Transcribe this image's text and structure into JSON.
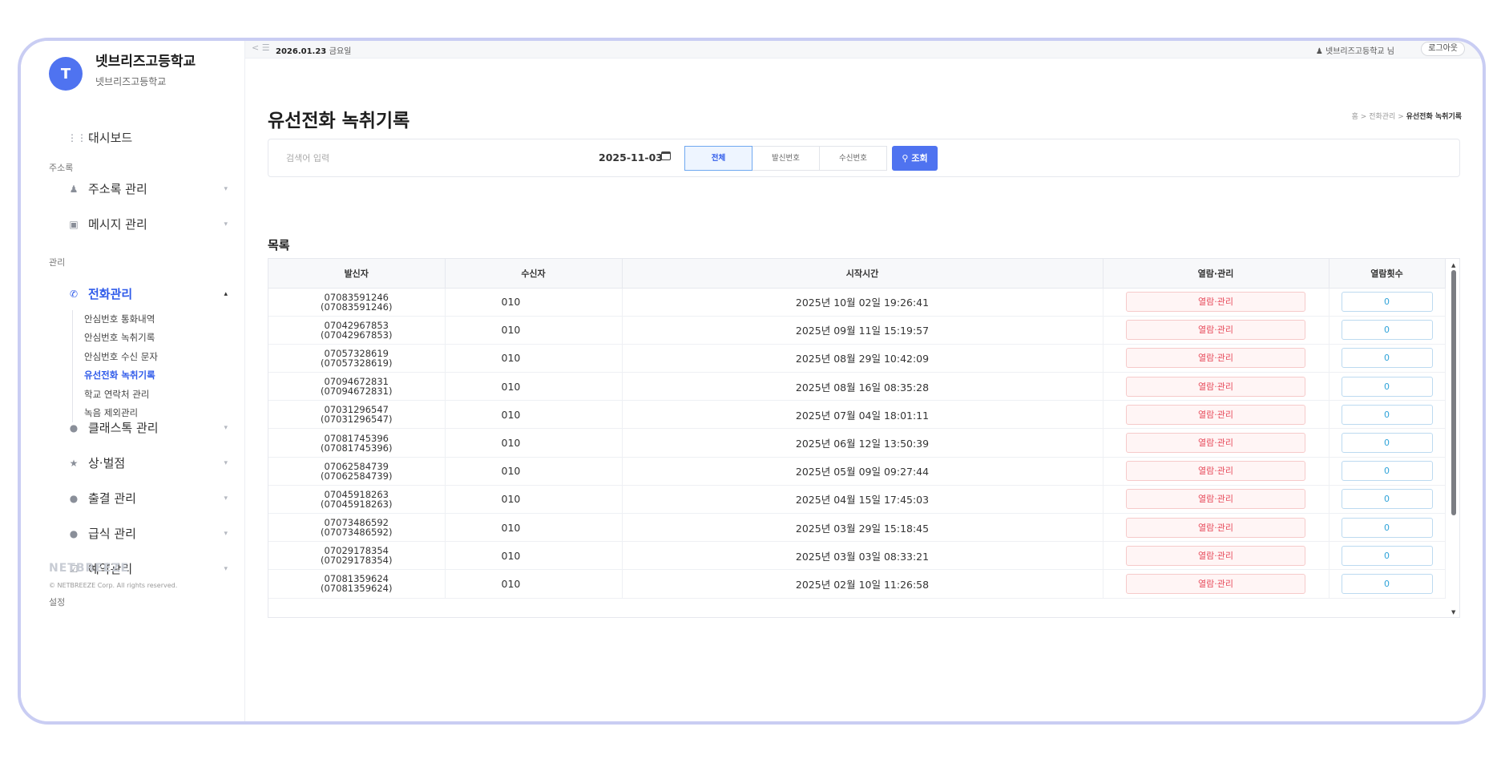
{
  "sidebar": {
    "avatar_letter": "T",
    "school_name": "넷브리즈고등학교",
    "school_sub": "넷브리즈고등학교",
    "dashboard": "대시보드",
    "section_addressbook": "주소록",
    "addressbook_mgmt": "주소록 관리",
    "message_mgmt": "메시지 관리",
    "section_mgmt": "관리",
    "phone_mgmt": "전화관리",
    "submenu": [
      "안심번호 통화내역",
      "안심번호 녹취기록",
      "안심번호 수신 문자",
      "유선전화 녹취기록",
      "학교 연락처 관리",
      "녹음 제외관리"
    ],
    "class_talk": "클래스톡 관리",
    "award": "상·벌점",
    "attendance": "출결 관리",
    "meal": "급식 관리",
    "reservation": "예약관리",
    "section_settings": "설정",
    "footer_logo": "NETBREEZE",
    "footer_copy": "© NETBREEZE Corp. All rights reserved."
  },
  "topbar": {
    "date": "2026.01.23",
    "weekday": "금요일",
    "user": "넷브리즈고등학교",
    "user_suffix": "님",
    "logout": "로그아웃"
  },
  "page": {
    "title": "유선전화 녹취기록",
    "breadcrumb_home": "홈",
    "breadcrumb_sep": ">",
    "breadcrumb_mid": "전화관리",
    "breadcrumb_current": "유선전화 녹취기록"
  },
  "search": {
    "placeholder": "검색어 입력",
    "date": "2025-11-03",
    "segments": [
      "전체",
      "발신번호",
      "수신번호"
    ],
    "button": "조회"
  },
  "list": {
    "title": "목록",
    "columns": [
      "발신자",
      "수신자",
      "시작시간",
      "열람·관리",
      "열람횟수"
    ],
    "open_label": "열람·관리",
    "rows": [
      {
        "sender": "07083591246",
        "sender_paren": "(07083591246)",
        "receiver": "010",
        "start": "2025년 10월 02일 19:26:41",
        "count": "0"
      },
      {
        "sender": "07042967853",
        "sender_paren": "(07042967853)",
        "receiver": "010",
        "start": "2025년 09월 11일 15:19:57",
        "count": "0"
      },
      {
        "sender": "07057328619",
        "sender_paren": "(07057328619)",
        "receiver": "010",
        "start": "2025년 08월 29일 10:42:09",
        "count": "0"
      },
      {
        "sender": "07094672831",
        "sender_paren": "(07094672831)",
        "receiver": "010",
        "start": "2025년 08월 16일 08:35:28",
        "count": "0"
      },
      {
        "sender": "07031296547",
        "sender_paren": "(07031296547)",
        "receiver": "010",
        "start": "2025년 07월 04일 18:01:11",
        "count": "0"
      },
      {
        "sender": "07081745396",
        "sender_paren": "(07081745396)",
        "receiver": "010",
        "start": "2025년 06월 12일 13:50:39",
        "count": "0"
      },
      {
        "sender": "07062584739",
        "sender_paren": "(07062584739)",
        "receiver": "010",
        "start": "2025년 05월 09일 09:27:44",
        "count": "0"
      },
      {
        "sender": "07045918263",
        "sender_paren": "(07045918263)",
        "receiver": "010",
        "start": "2025년 04월 15일 17:45:03",
        "count": "0"
      },
      {
        "sender": "07073486592",
        "sender_paren": "(07073486592)",
        "receiver": "010",
        "start": "2025년 03월 29일 15:18:45",
        "count": "0"
      },
      {
        "sender": "07029178354",
        "sender_paren": "(07029178354)",
        "receiver": "010",
        "start": "2025년 03월 03일 08:33:21",
        "count": "0"
      },
      {
        "sender": "07081359624",
        "sender_paren": "(07081359624)",
        "receiver": "010",
        "start": "2025년 02월 10일 11:26:58",
        "count": "0"
      }
    ]
  },
  "colors": {
    "accent": "#4f73f0",
    "active_nav": "#2f5bea",
    "open_button_text": "#e74c5c",
    "count_text": "#2fa3d9",
    "frame_border": "#c9cdf3"
  }
}
